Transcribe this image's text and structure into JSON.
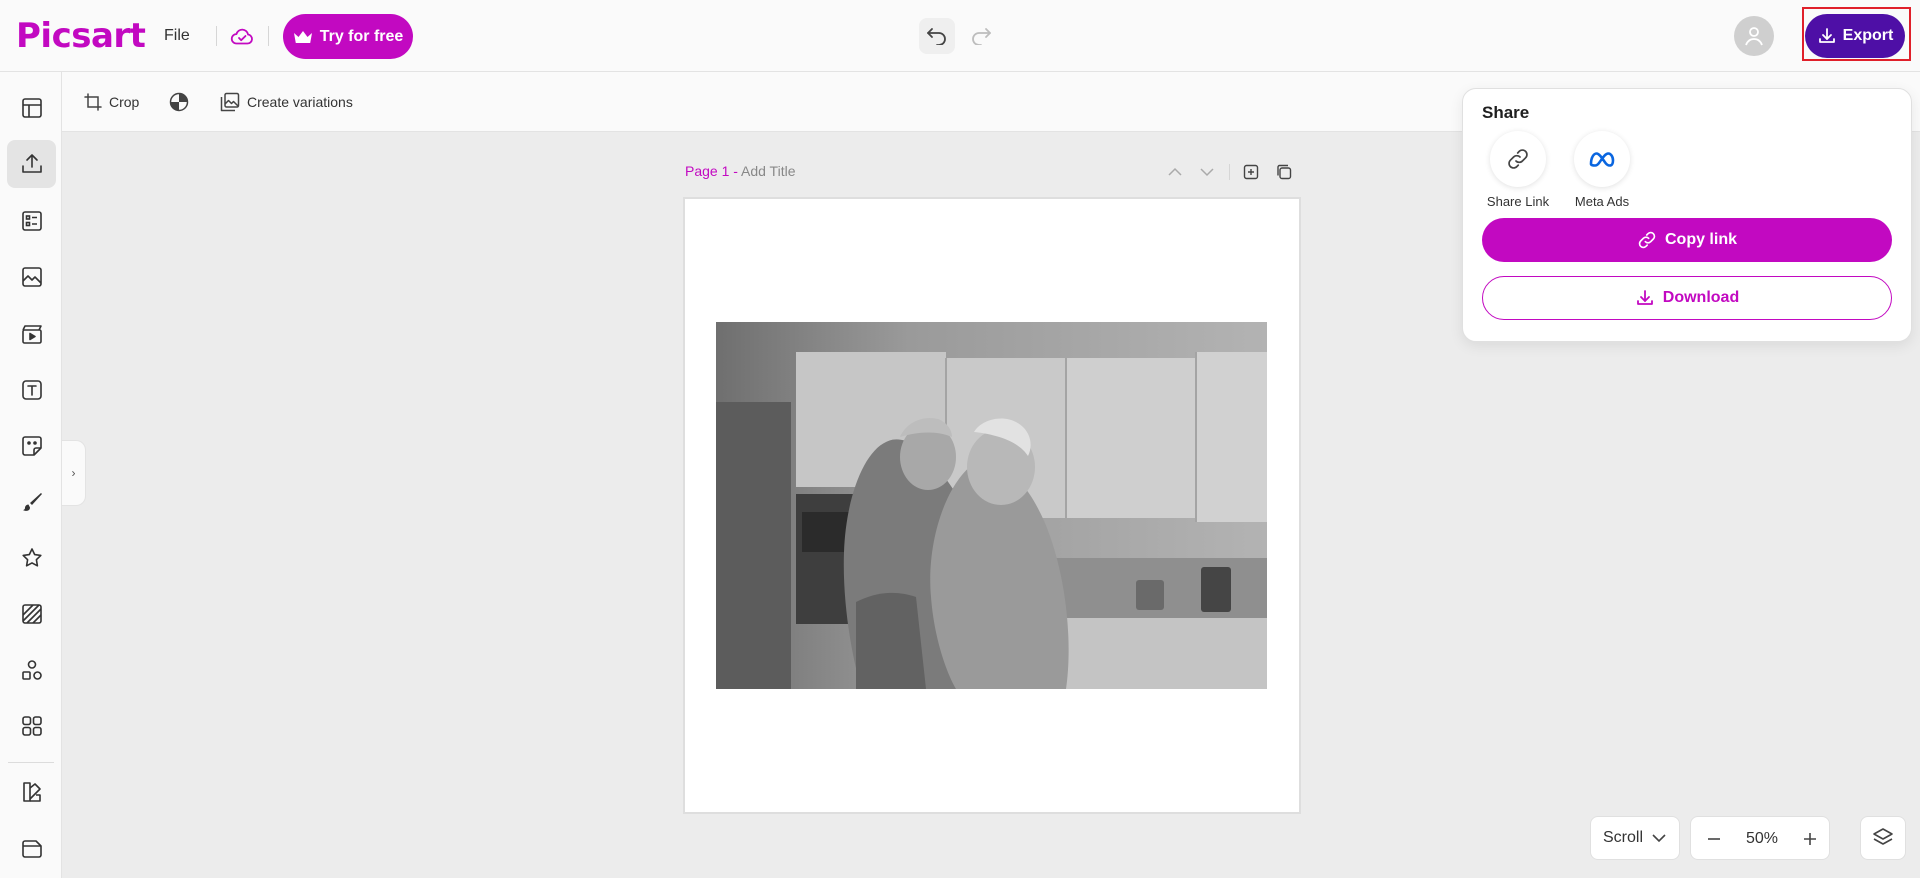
{
  "app": {
    "logo_text": "Picsart"
  },
  "topbar": {
    "file_label": "File",
    "try_label": "Try for free",
    "export_label": "Export"
  },
  "toolbar": {
    "crop_label": "Crop",
    "variations_label": "Create variations"
  },
  "canvas": {
    "page_label": "Page 1 -",
    "page_title_placeholder": "Add Title"
  },
  "share": {
    "title": "Share",
    "options": [
      {
        "label": "Share Link",
        "icon": "link-icon"
      },
      {
        "label": "Meta Ads",
        "icon": "meta-icon"
      }
    ],
    "copy_label": "Copy link",
    "download_label": "Download"
  },
  "view": {
    "scroll_label": "Scroll",
    "zoom": "50%"
  },
  "colors": {
    "brand": "#c209c1",
    "export": "#4e0fa6",
    "highlight": "#e0202a"
  }
}
